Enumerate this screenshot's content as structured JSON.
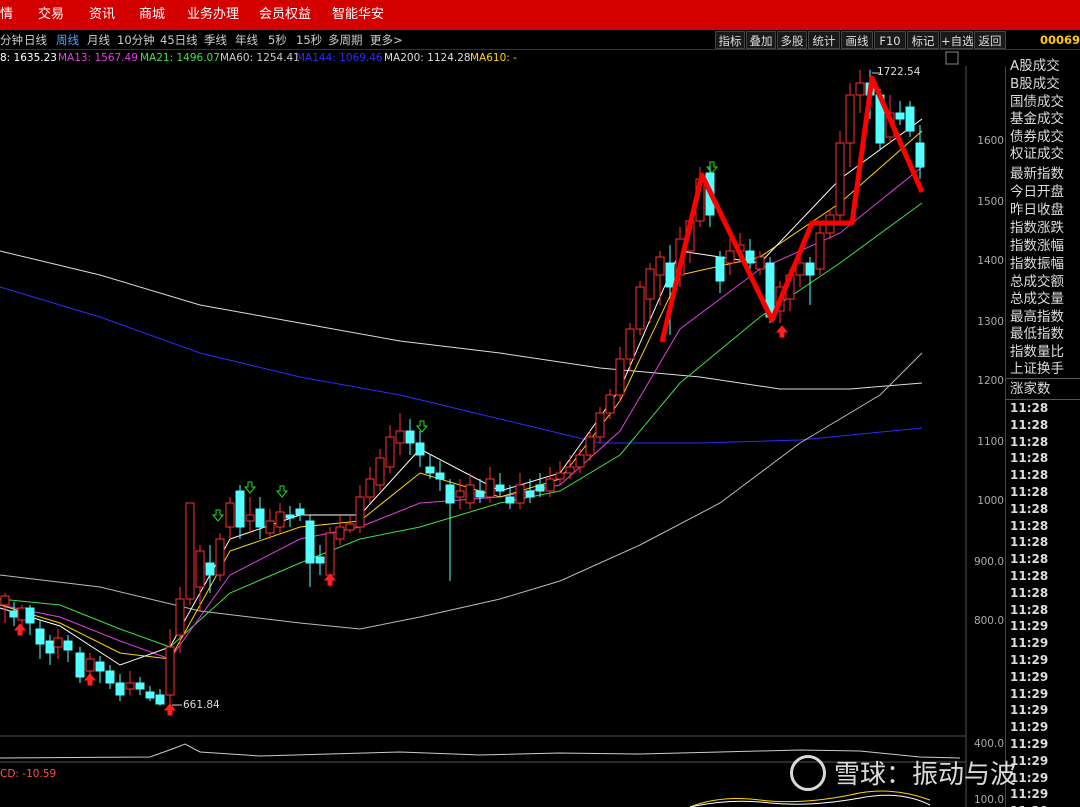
{
  "nav": [
    "情",
    "交易",
    "资讯",
    "商城",
    "业务办理",
    "会员权益",
    "智能华安"
  ],
  "periods": [
    "分钟",
    "日线",
    "周线",
    "月线",
    "10分钟",
    "45日线",
    "季线",
    "年线",
    "5秒",
    "15秒",
    "多周期",
    "更多>"
  ],
  "active_period": "周线",
  "tools": [
    "指标",
    "叠加",
    "多股",
    "统计",
    "画线",
    "F10",
    "标记",
    "+自选",
    "返回"
  ],
  "stock_code": "00069",
  "ma_legend": [
    {
      "label": "8: 1635.23",
      "color": "#ffffff"
    },
    {
      "label": "MA13: 1567.49",
      "color": "#e040e0"
    },
    {
      "label": "MA21: 1496.07",
      "color": "#40e040"
    },
    {
      "label": "MA60: 1254.41",
      "color": "#cccccc"
    },
    {
      "label": "MA144: 1069.46",
      "color": "#2c2cff"
    },
    {
      "label": "MA200: 1124.28",
      "color": "#dddddd"
    },
    {
      "label": "MA610: -",
      "color": "#ffd700"
    }
  ],
  "price_axis": [
    "1600",
    "1500",
    "1400",
    "1300",
    "1200",
    "1100",
    "1000",
    "900.0",
    "800.0"
  ],
  "macd_axis": [
    "400.0",
    "100.0"
  ],
  "annotations": {
    "high": "1722.54",
    "low": "661.84"
  },
  "macd_label": "CD: -10.59",
  "panel_items": [
    "A股成交",
    "B股成交",
    "国债成交",
    "基金成交",
    "债券成交",
    "权证成交",
    "最新指数",
    "今日开盘",
    "昨日收盘",
    "指数涨跌",
    "指数涨幅",
    "指数振幅",
    "总成交额",
    "总成交量",
    "最高指数",
    "最低指数",
    "指数量比",
    "上证换手",
    "涨家数"
  ],
  "ticks": [
    "11:28",
    "11:28",
    "11:28",
    "11:28",
    "11:28",
    "11:28",
    "11:28",
    "11:28",
    "11:28",
    "11:28",
    "11:28",
    "11:28",
    "11:28",
    "11:29",
    "11:29",
    "11:29",
    "11:29",
    "11:29",
    "11:29",
    "11:29",
    "11:29",
    "11:29",
    "11:29",
    "11:29",
    "11:29"
  ],
  "watermark": "雪球：振动与波",
  "colors": {
    "up": "#ff3030",
    "down": "#55ffff",
    "nav_bg": "#d40000",
    "trend_line": "#ff0000"
  }
}
